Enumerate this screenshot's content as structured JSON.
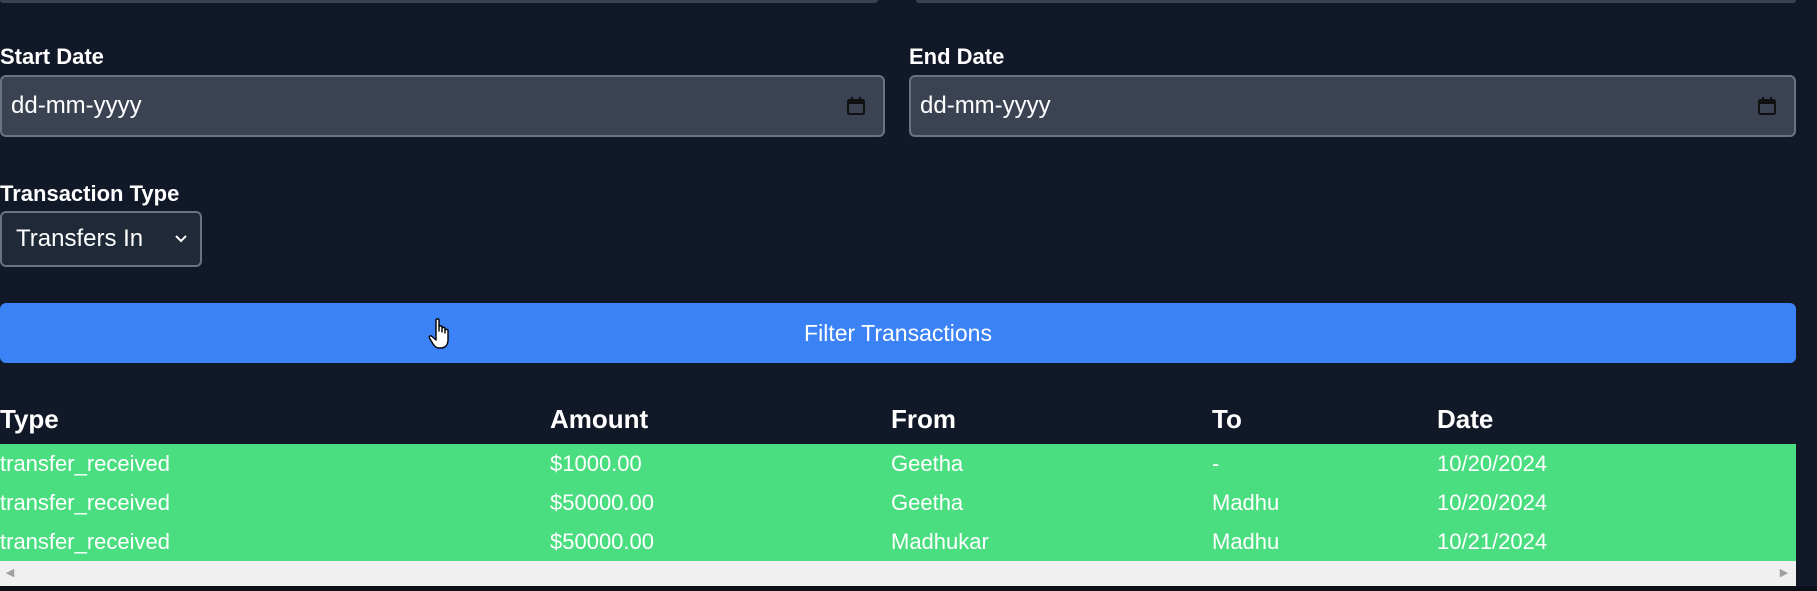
{
  "form": {
    "start_date": {
      "label": "Start Date",
      "placeholder": "dd-mm-yyyy"
    },
    "end_date": {
      "label": "End Date",
      "placeholder": "dd-mm-yyyy"
    },
    "transaction_type": {
      "label": "Transaction Type",
      "selected": "Transfers In"
    },
    "filter_button_label": "Filter Transactions"
  },
  "table": {
    "columns": [
      "Type",
      "Amount",
      "From",
      "To",
      "Date"
    ],
    "rows": [
      {
        "type": "transfer_received",
        "amount": "$1000.00",
        "from": "Geetha",
        "to": "-",
        "date": "10/20/2024"
      },
      {
        "type": "transfer_received",
        "amount": "$50000.00",
        "from": "Geetha",
        "to": "Madhu",
        "date": "10/20/2024"
      },
      {
        "type": "transfer_received",
        "amount": "$50000.00",
        "from": "Madhukar",
        "to": "Madhu",
        "date": "10/21/2024"
      }
    ],
    "row_color": "#4ade80"
  },
  "colors": {
    "background": "#111827",
    "accent": "#3b82f6",
    "input_bg": "#3b4353"
  },
  "icons": {
    "date_picker": "calendar-icon",
    "select": "chevron-down-icon",
    "cursor": "hand-pointer-icon"
  }
}
